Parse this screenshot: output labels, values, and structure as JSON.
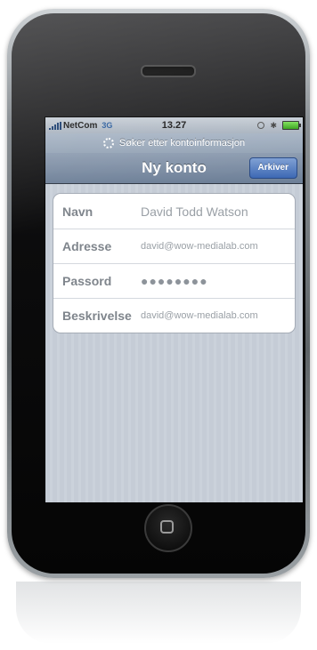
{
  "statusbar": {
    "carrier": "NetCom",
    "network": "3G",
    "time": "13.27",
    "bluetooth_glyph": "✱"
  },
  "prompt": {
    "text": "Søker etter kontoinformasjon"
  },
  "navbar": {
    "title": "Ny konto",
    "save_label": "Arkiver"
  },
  "form": {
    "rows": [
      {
        "label": "Navn",
        "value": "David Todd Watson"
      },
      {
        "label": "Adresse",
        "value": "david@wow-medialab.com"
      },
      {
        "label": "Passord",
        "value": "●●●●●●●●"
      },
      {
        "label": "Beskrivelse",
        "value": "david@wow-medialab.com"
      }
    ]
  },
  "icons": {
    "signal": "signal-bars-icon",
    "lock": "orientation-lock-icon",
    "bluetooth": "bluetooth-icon",
    "battery": "battery-icon",
    "spinner": "spinner-icon",
    "home": "home-button-icon"
  },
  "colors": {
    "navbar": "#6d7f97",
    "save_button": "#3d69b4",
    "battery": "#39a41c"
  }
}
